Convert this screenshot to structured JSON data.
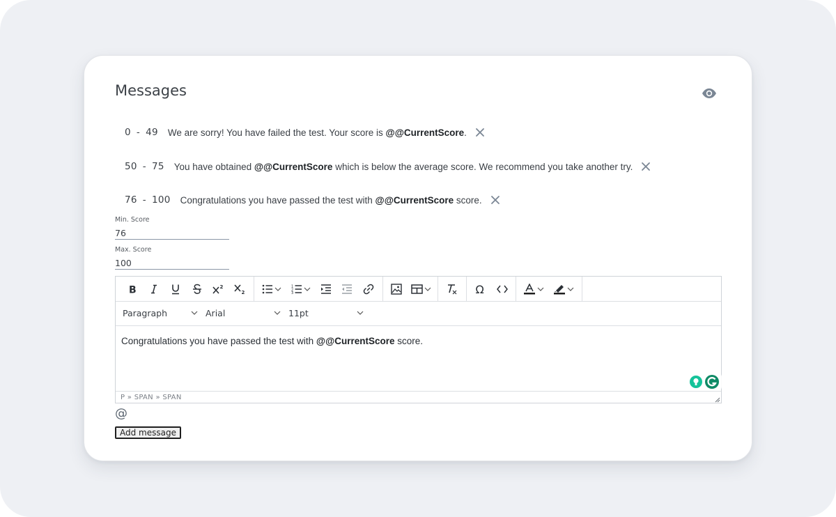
{
  "section": {
    "title": "Messages",
    "preview_icon": "eye-icon"
  },
  "messages": [
    {
      "min": "0",
      "dash": "-",
      "max": "49",
      "text_before": "We are sorry! You have failed the test. Your score is ",
      "token": "@@CurrentScore",
      "text_after": ".",
      "remove_icon": "close-icon"
    },
    {
      "min": "50",
      "dash": "-",
      "max": "75",
      "text_before": "You have obtained ",
      "token": "@@CurrentScore",
      "text_after": " which is below the average score. We recommend you take another try.",
      "remove_icon": "close-icon"
    },
    {
      "min": "76",
      "dash": "-",
      "max": "100",
      "text_before": "Congratulations you have passed the test with ",
      "token": "@@CurrentScore",
      "text_after": " score.",
      "remove_icon": "close-icon"
    }
  ],
  "form": {
    "min_label": "Min. Score",
    "min_value": "76",
    "max_label": "Max. Score",
    "max_value": "100"
  },
  "editor": {
    "toolbar_icons": [
      "bold-icon",
      "italic-icon",
      "underline-icon",
      "strikethrough-icon",
      "superscript-icon",
      "subscript-icon",
      "bullet-list-icon",
      "numbered-list-icon",
      "indent-icon",
      "outdent-icon",
      "link-icon",
      "image-icon",
      "table-icon",
      "clear-formatting-icon",
      "special-character-icon",
      "source-code-icon",
      "text-color-icon",
      "highlight-color-icon"
    ],
    "block_format": "Paragraph",
    "font_family": "Arial",
    "font_size": "11pt",
    "content_before": "Congratulations you have passed the test with ",
    "content_token": "@@CurrentScore",
    "content_after": " score.",
    "status_path": "P » SPAN » SPAN",
    "text_color": "#1e1e1e",
    "highlight_color": "#1e1e1e"
  },
  "actions": {
    "at_symbol": "@",
    "add_label": "Add message"
  },
  "colors": {
    "page_bg": "#eef0f4",
    "card_bg": "#ffffff",
    "grammarly_green": "#15c39a",
    "grammarly_dark": "#0f8a66",
    "icon_gray": "#7a8694"
  }
}
